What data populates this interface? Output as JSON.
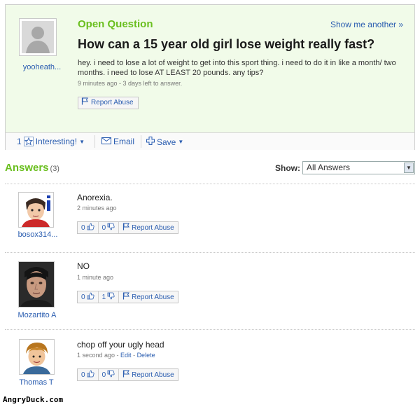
{
  "question": {
    "kicker": "Open Question",
    "show_another": "Show me another »",
    "title": "How can a 15 year old girl lose weight really fast?",
    "body": "hey. i need to lose a lot of weight to get into this sport thing. i need to do it in like a month/ two months. i need to lose AT LEAST 20 pounds. any tips?",
    "meta": "9 minutes ago - 3 days left to answer.",
    "asker": "yooheath...",
    "report_label": "Report Abuse"
  },
  "actions": {
    "interesting_count": "1",
    "interesting_label": "Interesting!",
    "email_label": "Email",
    "save_label": "Save"
  },
  "answers_header": {
    "title": "Answers",
    "count": "(3)",
    "show_label": "Show:",
    "show_value": "All Answers"
  },
  "answers": [
    {
      "user": "bosox314...",
      "text": "Anorexia.",
      "meta": "2 minutes ago",
      "edit": "",
      "delete": "",
      "thumbs_up": "0",
      "thumbs_down": "0",
      "report": "Report Abuse"
    },
    {
      "user": "Mozartito A",
      "text": "NO",
      "meta": "1 minute ago",
      "edit": "",
      "delete": "",
      "thumbs_up": "0",
      "thumbs_down": "1",
      "report": "Report Abuse"
    },
    {
      "user": "Thomas T",
      "text": "chop off your ugly head",
      "meta": "1 second ago - ",
      "edit": "Edit",
      "delete": "Delete",
      "thumbs_up": "0",
      "thumbs_down": "0",
      "report": "Report Abuse"
    }
  ],
  "watermark": "AngryDuck.com",
  "colors": {
    "accent_green": "#6abf1f",
    "link_blue": "#2a5db0",
    "question_bg": "#f1fbe9"
  }
}
